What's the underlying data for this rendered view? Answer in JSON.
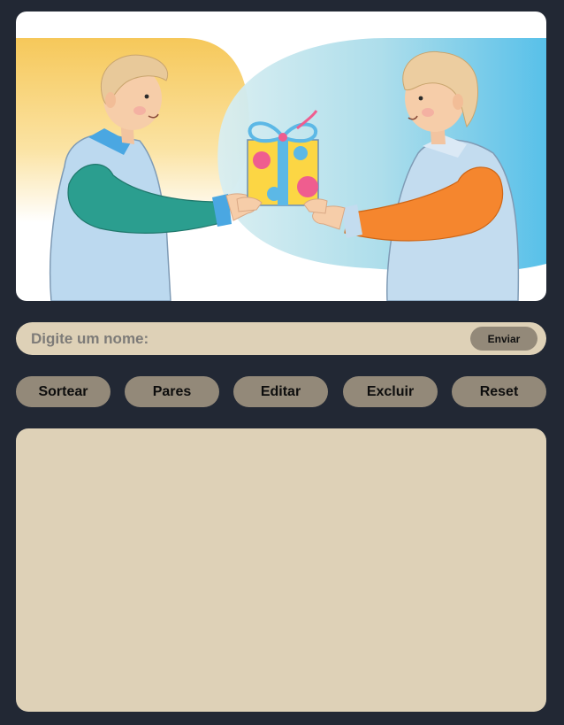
{
  "hero": {
    "illustration": "two-people-exchanging-gift"
  },
  "name_entry": {
    "placeholder": "Digite um nome:",
    "value": "",
    "submit_label": "Enviar"
  },
  "actions": {
    "draw_label": "Sortear",
    "pairs_label": "Pares",
    "edit_label": "Editar",
    "delete_label": "Excluir",
    "reset_label": "Reset"
  },
  "results": {
    "items": []
  },
  "colors": {
    "page_background": "#222834",
    "panel_beige": "#ded1b7",
    "button_taupe": "#938979"
  }
}
